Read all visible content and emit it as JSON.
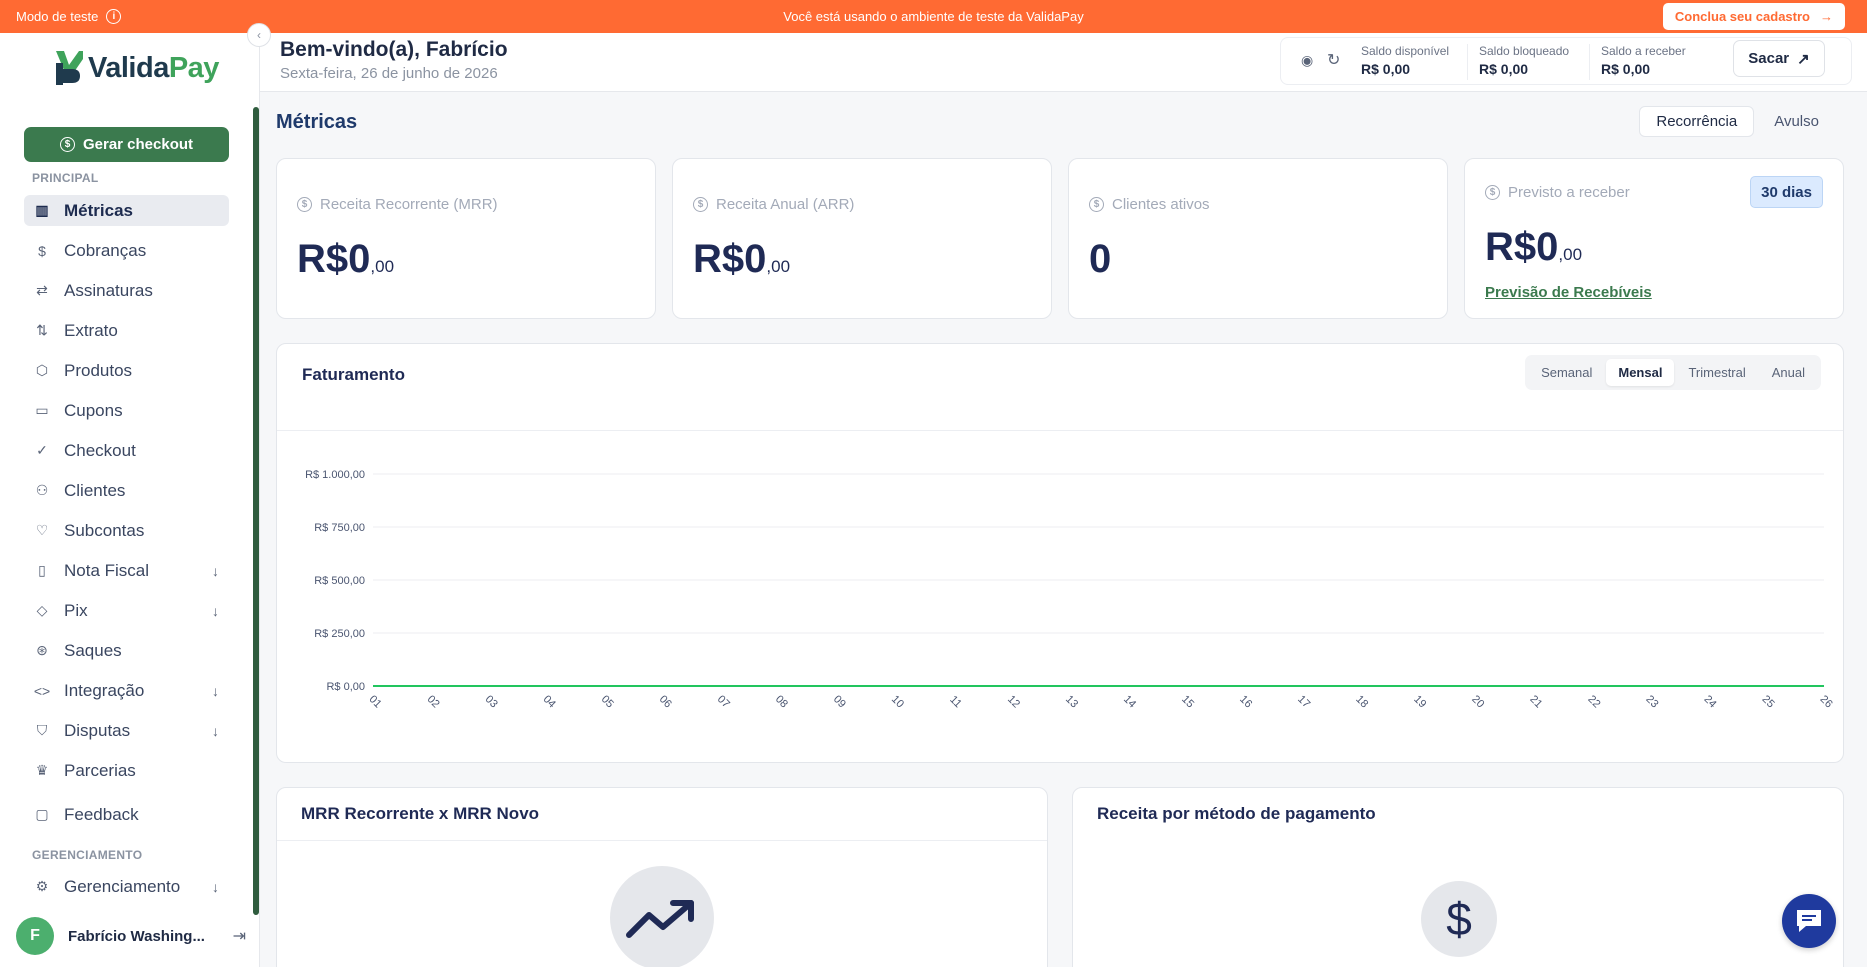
{
  "banner": {
    "mode_label": "Modo de teste",
    "message": "Você está usando o ambiente de teste da ValidaPay",
    "cta_label": "Conclua seu cadastro"
  },
  "brand": {
    "name_part1": "Valida",
    "name_part2": "Pay",
    "accent": "#3fa35b",
    "banner_color": "#ff6a33"
  },
  "sidebar": {
    "generate_button": "Gerar checkout",
    "section_principal": "PRINCIPAL",
    "items": [
      {
        "label": "Métricas",
        "icon": "chart-icon",
        "active": true
      },
      {
        "label": "Cobranças",
        "icon": "dollar-icon"
      },
      {
        "label": "Assinaturas",
        "icon": "repeat-icon"
      },
      {
        "label": "Extrato",
        "icon": "arrows-updown-icon"
      },
      {
        "label": "Produtos",
        "icon": "box-icon"
      },
      {
        "label": "Cupons",
        "icon": "ticket-icon"
      },
      {
        "label": "Checkout",
        "icon": "check-circle-icon"
      },
      {
        "label": "Clientes",
        "icon": "users-icon"
      },
      {
        "label": "Subcontas",
        "icon": "handshake-icon"
      },
      {
        "label": "Nota Fiscal",
        "icon": "file-icon",
        "expandable": true
      },
      {
        "label": "Pix",
        "icon": "pix-icon",
        "expandable": true
      },
      {
        "label": "Saques",
        "icon": "coin-icon"
      },
      {
        "label": "Integração",
        "icon": "code-icon",
        "expandable": true
      },
      {
        "label": "Disputas",
        "icon": "shield-icon",
        "expandable": true
      },
      {
        "label": "Parcerias",
        "icon": "crown-icon"
      }
    ],
    "feedback": "Feedback",
    "section_gerenciamento": "GERENCIAMENTO",
    "gerenciamento": "Gerenciamento",
    "user": {
      "initial": "F",
      "name": "Fabrício Washing..."
    }
  },
  "header": {
    "welcome": "Bem-vindo(a), Fabrício",
    "date": "Sexta-feira, 26 de junho de 2026",
    "balances": [
      {
        "label": "Saldo disponível",
        "value": "R$ 0,00"
      },
      {
        "label": "Saldo bloqueado",
        "value": "R$ 0,00"
      },
      {
        "label": "Saldo a receber",
        "value": "R$ 0,00"
      }
    ],
    "withdraw_label": "Sacar"
  },
  "metrics": {
    "title": "Métricas",
    "tabs": [
      "Recorrência",
      "Avulso"
    ],
    "cards": [
      {
        "label": "Receita Recorrente (MRR)",
        "value": "R$0",
        "cents": ",00"
      },
      {
        "label": "Receita Anual (ARR)",
        "value": "R$0",
        "cents": ",00"
      },
      {
        "label": "Clientes ativos",
        "value": "0"
      },
      {
        "label": "Previsto a receber",
        "value": "R$0",
        "cents": ",00",
        "badge": "30 dias",
        "link": "Previsão de Recebíveis"
      }
    ]
  },
  "billing": {
    "title": "Faturamento",
    "periods": [
      "Semanal",
      "Mensal",
      "Trimestral",
      "Anual"
    ],
    "selected_period": "Mensal"
  },
  "chart_data": {
    "type": "line",
    "title": "Faturamento",
    "x": [
      "01",
      "02",
      "03",
      "04",
      "05",
      "06",
      "07",
      "08",
      "09",
      "10",
      "11",
      "12",
      "13",
      "14",
      "15",
      "16",
      "17",
      "18",
      "19",
      "20",
      "21",
      "22",
      "23",
      "24",
      "25",
      "26"
    ],
    "series": [
      {
        "values": [
          0,
          0,
          0,
          0,
          0,
          0,
          0,
          0,
          0,
          0,
          0,
          0,
          0,
          0,
          0,
          0,
          0,
          0,
          0,
          0,
          0,
          0,
          0,
          0,
          0,
          0
        ],
        "color": "#22c55e"
      }
    ],
    "yticks": [
      "R$ 0,00",
      "R$ 250,00",
      "R$ 500,00",
      "R$ 750,00",
      "R$ 1.000,00"
    ],
    "ylim": [
      0,
      1000
    ],
    "grid": true
  },
  "bottom": {
    "mrr_title": "MRR Recorrente x MRR Novo",
    "payment_title": "Receita por método de pagamento"
  }
}
